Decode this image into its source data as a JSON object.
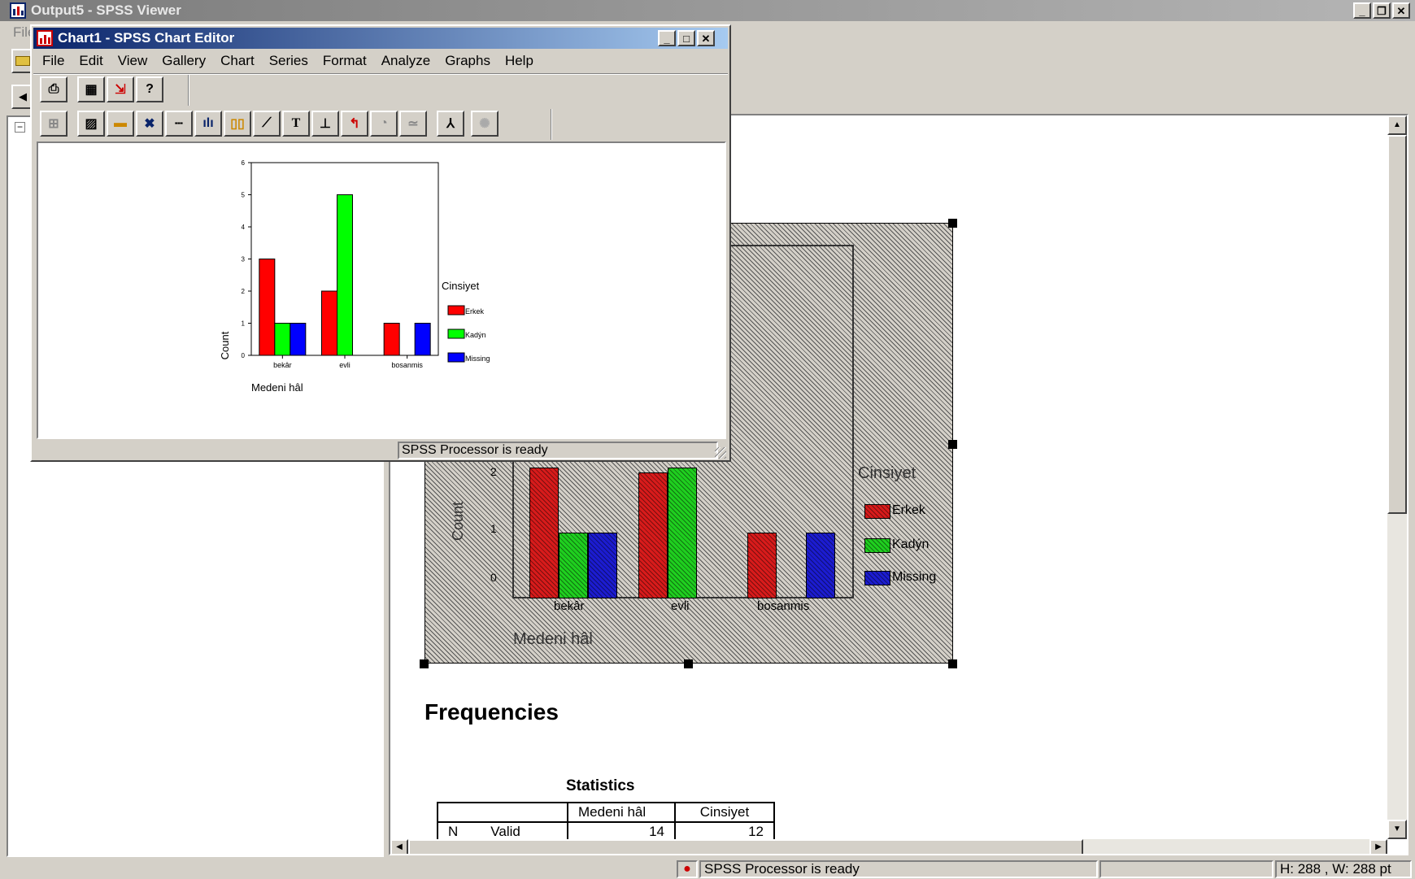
{
  "viewer": {
    "title": "Output5 - SPSS Viewer",
    "menu_fragment": "File",
    "status": "SPSS Processor  is ready",
    "dims": "H: 288 , W: 288 pt"
  },
  "editor": {
    "title": "Chart1 - SPSS Chart Editor",
    "menu": [
      "File",
      "Edit",
      "View",
      "Gallery",
      "Chart",
      "Series",
      "Format",
      "Analyze",
      "Graphs",
      "Help"
    ],
    "status": "SPSS Processor  is ready"
  },
  "colors": {
    "erkek": "#ff0000",
    "kadin": "#00ff00",
    "missing": "#0000ff",
    "desktop": "#1a1aa6",
    "titlebar": "#0a246a"
  },
  "chart_data": [
    {
      "type": "bar",
      "categories": [
        "bekâr",
        "evli",
        "boşanmış"
      ],
      "series": [
        {
          "name": "Erkek",
          "values": [
            3,
            2,
            1
          ]
        },
        {
          "name": "Kadýn",
          "values": [
            1,
            5,
            0
          ]
        },
        {
          "name": "Missing",
          "values": [
            1,
            0,
            1
          ]
        }
      ],
      "xlabel": "Medeni hâl",
      "ylabel": "Count",
      "ylim": [
        0,
        6
      ],
      "yticks": [
        "0",
        "1",
        "2",
        "3",
        "4",
        "5",
        "6"
      ],
      "legend_title": "Cinsiyet",
      "legend_position": "right",
      "tick_labels": [
        "bekâr",
        "evli",
        "bosanmis"
      ],
      "legend_labels": [
        "Erkek",
        "Kadýn",
        "Missing"
      ]
    }
  ],
  "bg_chart": {
    "yticks": [
      "0",
      "1",
      "2"
    ],
    "ylabel": "Count",
    "xlabel": "Medeni hâl",
    "tick_labels": [
      "bekâr",
      "evli",
      "bosanmis"
    ],
    "legend_title": "Cinsiyet",
    "legend_labels": [
      "Erkek",
      "Kadýn",
      "Missing"
    ]
  },
  "frequencies": {
    "heading": "Frequencies",
    "table_title": "Statistics",
    "col1": "Medeni hâl",
    "col2": "Cinsiyet",
    "row_n": "N",
    "row_valid": "Valid",
    "v1": "14",
    "v2": "12"
  }
}
